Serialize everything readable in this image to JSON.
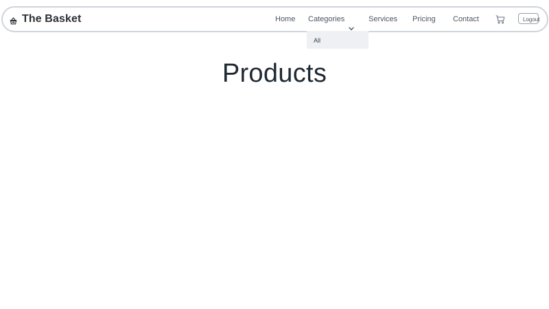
{
  "navbar": {
    "brand": {
      "title": "The Basket",
      "icon": "basket-icon"
    },
    "links": {
      "home": "Home",
      "categories": "Categories",
      "services": "Services",
      "pricing": "Pricing",
      "contact": "Contact"
    },
    "cart_icon": "cart-icon",
    "logout_label": "Logout"
  },
  "categories_dropdown": {
    "items": [
      "All"
    ]
  },
  "main": {
    "title": "Products"
  },
  "colors": {
    "text_primary": "#1f2933",
    "nav_text": "#4b5563",
    "border": "#cfd3da",
    "dropdown_bg": "#eef0f3"
  }
}
